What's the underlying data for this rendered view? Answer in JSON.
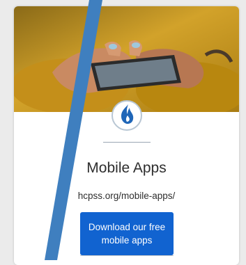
{
  "card": {
    "image_alt": "Hands holding a smartphone",
    "logo_icon": "flame-icon",
    "title": "Mobile Apps",
    "url": "hcpss.org/mobile-apps/",
    "button_label": "Download our free mobile apps"
  },
  "overlay": {
    "icon": "blue-diagonal-stroke",
    "color": "#3f7fbf"
  },
  "colors": {
    "accent": "#1163d0",
    "hero_yellow": "#c89a1e",
    "logo_blue": "#1f66b8"
  }
}
